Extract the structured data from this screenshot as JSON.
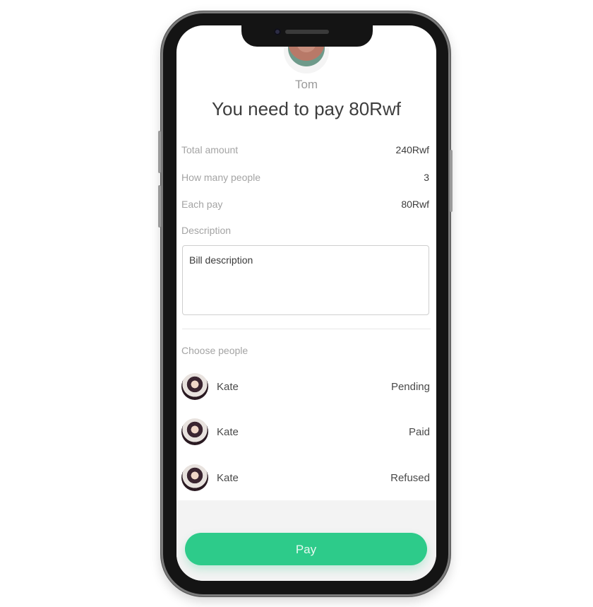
{
  "profile": {
    "name": "Tom"
  },
  "headline": "You need to pay 80Rwf",
  "summary": [
    {
      "label": "Total amount",
      "value": "240Rwf"
    },
    {
      "label": "How many people",
      "value": "3"
    },
    {
      "label": "Each pay",
      "value": "80Rwf"
    }
  ],
  "description": {
    "label": "Description",
    "value": "Bill description"
  },
  "people": {
    "label": "Choose people",
    "items": [
      {
        "name": "Kate",
        "status": "Pending"
      },
      {
        "name": "Kate",
        "status": "Paid"
      },
      {
        "name": "Kate",
        "status": "Refused"
      }
    ]
  },
  "actions": {
    "pay_label": "Pay"
  },
  "colors": {
    "accent": "#2dcb8a",
    "headline": "#3d3d3d",
    "muted": "#a4a4a4"
  }
}
